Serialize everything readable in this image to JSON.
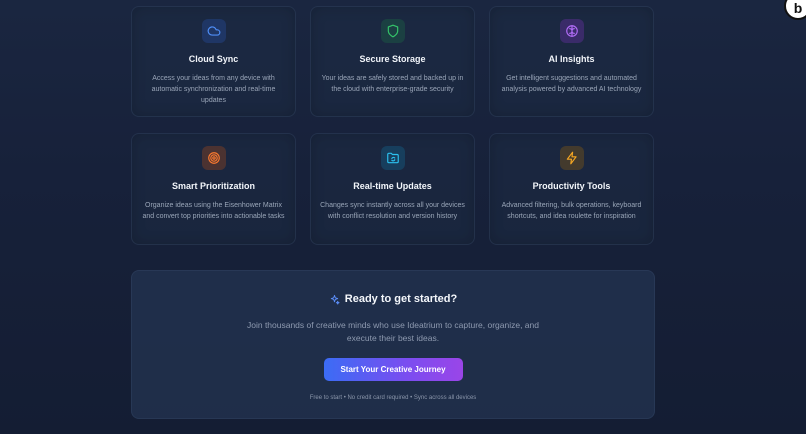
{
  "features": [
    {
      "title": "Cloud Sync",
      "desc": "Access your ideas from any device with automatic synchronization and real-time updates",
      "icon": "cloud-icon",
      "color": "#3b82f6"
    },
    {
      "title": "Secure Storage",
      "desc": "Your ideas are safely stored and backed up in the cloud with enterprise-grade security",
      "icon": "shield-icon",
      "color": "#22c55e"
    },
    {
      "title": "AI Insights",
      "desc": "Get intelligent suggestions and automated analysis powered by advanced AI technology",
      "icon": "brain-icon",
      "color": "#a855f7"
    },
    {
      "title": "Smart Prioritization",
      "desc": "Organize ideas using the Eisenhower Matrix and convert top priorities into actionable tasks",
      "icon": "target-icon",
      "color": "#f97316"
    },
    {
      "title": "Real-time Updates",
      "desc": "Changes sync instantly across all your devices with conflict resolution and version history",
      "icon": "folder-sync-icon",
      "color": "#22b8e6"
    },
    {
      "title": "Productivity Tools",
      "desc": "Advanced filtering, bulk operations, keyboard shortcuts, and idea roulette for inspiration",
      "icon": "lightning-icon",
      "color": "#f59e0b"
    }
  ],
  "cta": {
    "title": "Ready to get started?",
    "icon": "sparkles-icon",
    "desc": "Join thousands of creative minds who use Ideatrium to capture, organize, and execute their best ideas.",
    "button_label": "Start Your Creative Journey",
    "note": "Free to start • No credit card required • Sync across all devices"
  },
  "badge": {
    "label": "b"
  }
}
